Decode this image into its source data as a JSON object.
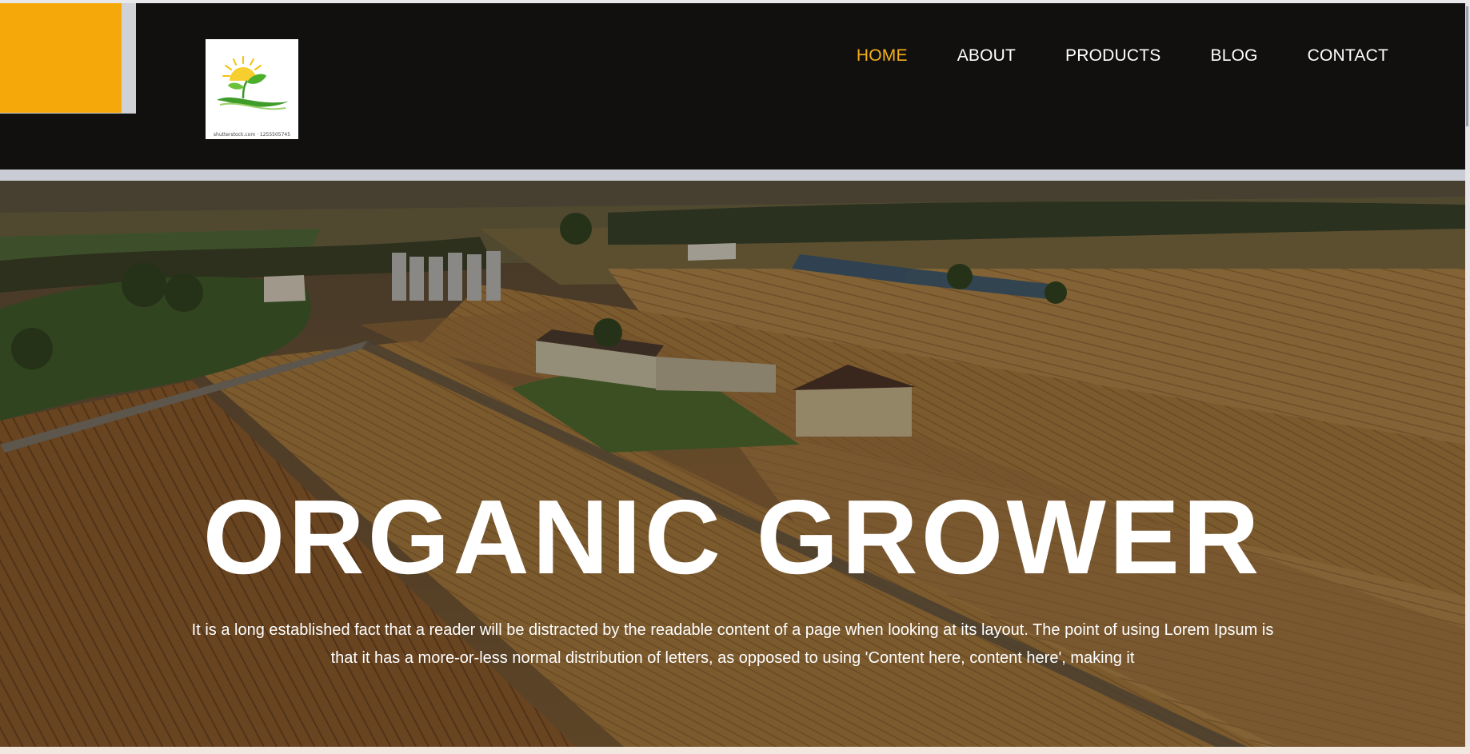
{
  "logo": {
    "alt": "Organic grower logo",
    "caption": "shutterstock.com · 1255505745"
  },
  "nav": {
    "items": [
      {
        "label": "HOME",
        "active": true
      },
      {
        "label": "ABOUT",
        "active": false
      },
      {
        "label": "PRODUCTS",
        "active": false
      },
      {
        "label": "BLOG",
        "active": false
      },
      {
        "label": "CONTACT",
        "active": false
      }
    ]
  },
  "hero": {
    "title": "ORGANIC GROWER",
    "description": "It is a long established fact that a reader will be distracted by the readable content of a page when looking at its layout. The point of using Lorem Ipsum is that it has a more-or-less normal distribution of letters, as opposed to using 'Content here, content here', making it",
    "background_image": "aerial-farmland-photo"
  },
  "colors": {
    "header_bg": "#12100e",
    "accent": "#f5a80a",
    "nav_active": "#f5b01a",
    "nav_default": "#ffffff"
  }
}
